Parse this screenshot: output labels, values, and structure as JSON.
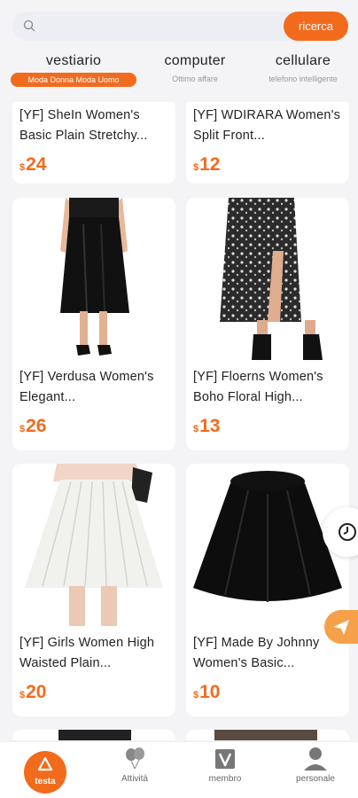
{
  "search": {
    "placeholder": "",
    "button_label": "ricerca",
    "icon": "search-icon"
  },
  "categories": [
    {
      "title": "vestiario",
      "subtitle": "Moda Donna Moda Uomo",
      "active": true
    },
    {
      "title": "computer",
      "subtitle": "Ottimo affare",
      "active": false
    },
    {
      "title": "cellulare",
      "subtitle": "telefono intelligente",
      "active": false
    }
  ],
  "currency_symbol": "$",
  "products": [
    {
      "title": "[YF] SheIn Women's Basic Plain Stretchy...",
      "price": "24"
    },
    {
      "title": "[YF] WDIRARA Women's Split Front...",
      "price": "12"
    },
    {
      "title": "[YF] Verdusa Women's Elegant...",
      "price": "26"
    },
    {
      "title": "[YF] Floerns Women's Boho Floral High...",
      "price": "13"
    },
    {
      "title": "[YF] Girls Women High Waisted Plain...",
      "price": "20"
    },
    {
      "title": "[YF] Made By Johnny Women's Basic...",
      "price": "10"
    }
  ],
  "floating": {
    "history_icon": "clock-icon",
    "share_icon": "send-icon"
  },
  "bottom_nav": [
    {
      "label": "testa",
      "icon": "home-icon",
      "active": true
    },
    {
      "label": "Attività",
      "icon": "balloons-icon",
      "active": false
    },
    {
      "label": "membro",
      "icon": "v-badge-icon",
      "active": false
    },
    {
      "label": "personale",
      "icon": "person-icon",
      "active": false
    }
  ],
  "colors": {
    "accent": "#f26b1d",
    "background": "#f4f4f6",
    "share_button": "#f6a04a"
  }
}
